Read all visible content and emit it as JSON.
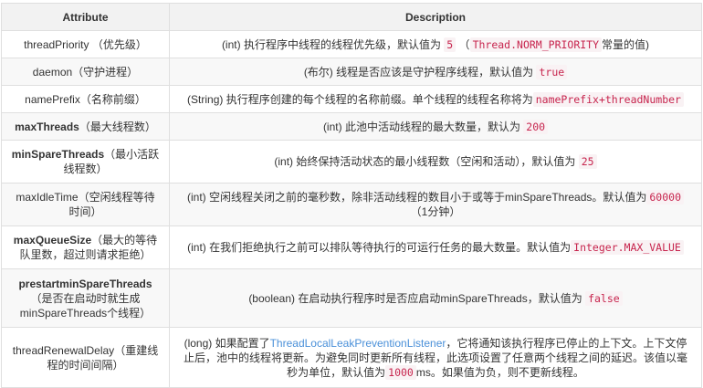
{
  "headers": {
    "attribute": "Attribute",
    "description": "Description"
  },
  "rows": [
    {
      "name": "threadPriority",
      "bold": false,
      "note": " （优先级）",
      "desc": [
        {
          "t": "text",
          "v": "(int) 执行程序中线程的线程优先级，默认值为 "
        },
        {
          "t": "code",
          "v": "5"
        },
        {
          "t": "text",
          "v": " （"
        },
        {
          "t": "code",
          "v": "Thread.NORM_PRIORITY"
        },
        {
          "t": "text",
          "v": "常量的值)"
        }
      ]
    },
    {
      "name": "daemon",
      "bold": false,
      "note": "（守护进程）",
      "desc": [
        {
          "t": "text",
          "v": "(布尔) 线程是否应该是守护程序线程，默认值为 "
        },
        {
          "t": "code",
          "v": "true"
        }
      ]
    },
    {
      "name": "namePrefix",
      "bold": false,
      "note": "（名称前缀）",
      "desc": [
        {
          "t": "text",
          "v": "(String) 执行程序创建的每个线程的名称前缀。单个线程的线程名称将为"
        },
        {
          "t": "code",
          "v": "namePrefix+threadNumber"
        }
      ]
    },
    {
      "name": "maxThreads",
      "bold": true,
      "note": "（最大线程数）",
      "desc": [
        {
          "t": "text",
          "v": "(int) 此池中活动线程的最大数量，默认为 "
        },
        {
          "t": "code",
          "v": "200"
        }
      ]
    },
    {
      "name": "minSpareThreads",
      "bold": true,
      "note": "（最小活跃线程数）",
      "desc": [
        {
          "t": "text",
          "v": "(int) 始终保持活动状态的最小线程数（空闲和活动），默认值为 "
        },
        {
          "t": "code",
          "v": "25"
        }
      ]
    },
    {
      "name": "maxIdleTime",
      "bold": false,
      "note": "（空闲线程等待时间）",
      "desc": [
        {
          "t": "text",
          "v": "(int) 空闲线程关闭之前的毫秒数，除非活动线程的数目小于或等于minSpareThreads。默认值为"
        },
        {
          "t": "code",
          "v": "60000"
        },
        {
          "t": "text",
          "v": " （1分钟）"
        }
      ]
    },
    {
      "name": "maxQueueSize",
      "bold": true,
      "note": "（最大的等待队里数，超过则请求拒绝）",
      "desc": [
        {
          "t": "text",
          "v": "(int) 在我们拒绝执行之前可以排队等待执行的可运行任务的最大数量。默认值为"
        },
        {
          "t": "code",
          "v": "Integer.MAX_VALUE"
        }
      ]
    },
    {
      "name": "prestartminSpareThreads",
      "bold": true,
      "note": "（是否在启动时就生成minSpareThreads个线程）",
      "desc": [
        {
          "t": "text",
          "v": "(boolean) 在启动执行程序时是否应启动minSpareThreads，默认值为 "
        },
        {
          "t": "code",
          "v": "false"
        }
      ]
    },
    {
      "name": "threadRenewalDelay",
      "bold": false,
      "note": "（重建线程的时间间隔）",
      "desc": [
        {
          "t": "text",
          "v": "(long) 如果配置了"
        },
        {
          "t": "link",
          "v": "ThreadLocalLeakPreventionListener"
        },
        {
          "t": "text",
          "v": "，它将通知该执行程序已停止的上下文。上下文停止后，池中的线程将更新。为避免同时更新所有线程，此选项设置了任意两个线程之间的延迟。该值以毫秒为单位，默认值为"
        },
        {
          "t": "code",
          "v": "1000"
        },
        {
          "t": "text",
          "v": "ms。如果值为负，则不更新线程。"
        }
      ]
    }
  ]
}
